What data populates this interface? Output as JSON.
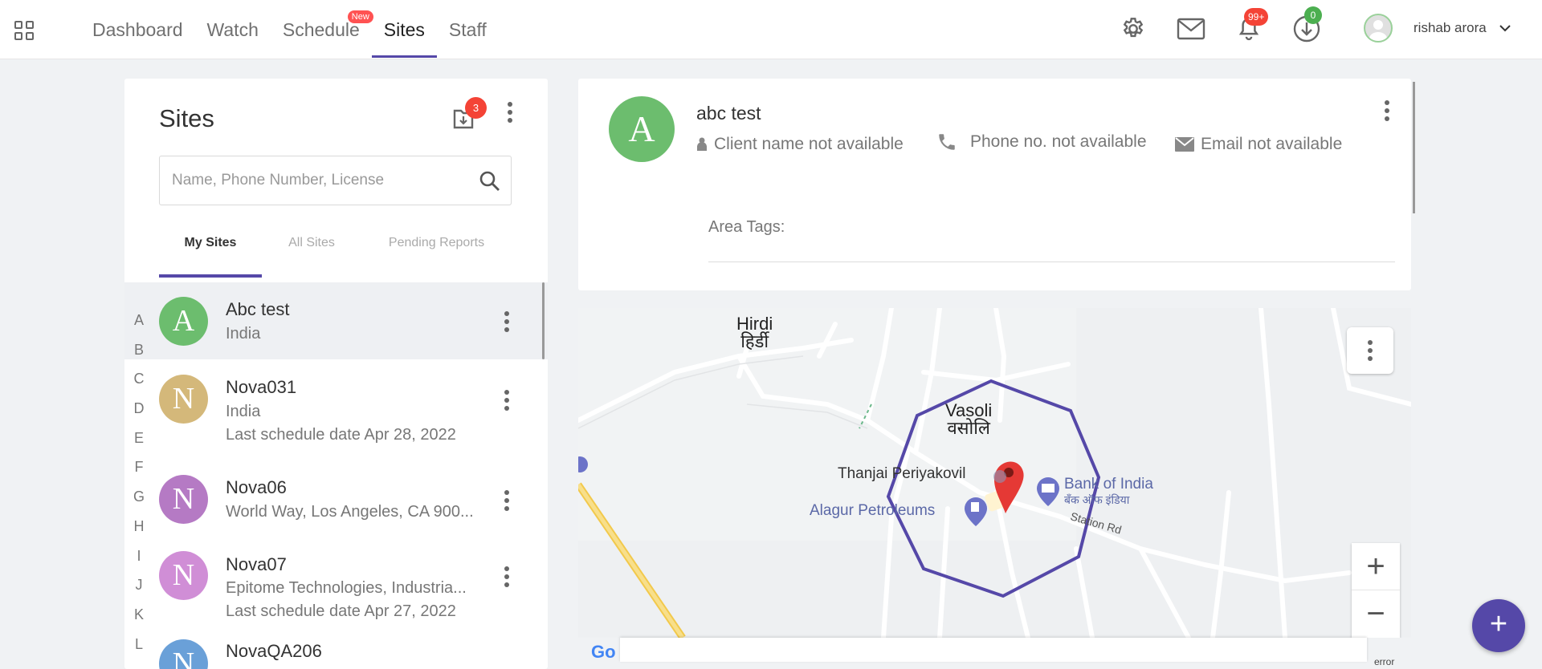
{
  "nav": {
    "tabs": [
      {
        "label": "Dashboard",
        "active": false
      },
      {
        "label": "Watch",
        "active": false
      },
      {
        "label": "Schedule",
        "active": false,
        "badge": "New"
      },
      {
        "label": "Sites",
        "active": true
      },
      {
        "label": "Staff",
        "active": false
      }
    ]
  },
  "header": {
    "notifications_badge": "99+",
    "downloads_badge": "0",
    "user_name": "rishab arora",
    "icons": [
      "settings-icon",
      "mail-icon",
      "bell-icon",
      "download-icon"
    ]
  },
  "sites_panel": {
    "title": "Sites",
    "download_badge": "3",
    "search_placeholder": "Name, Phone Number, License",
    "tabs": [
      "My Sites",
      "All Sites",
      "Pending Reports"
    ],
    "alphabet": [
      "A",
      "B",
      "C",
      "D",
      "E",
      "F",
      "G",
      "H",
      "I",
      "J",
      "K",
      "L"
    ],
    "items": [
      {
        "initial": "A",
        "name": "Abc test",
        "line1": "India",
        "line2": "",
        "color": "#6cbd6e"
      },
      {
        "initial": "N",
        "name": "Nova031",
        "line1": "India",
        "line2": "Last schedule date Apr 28, 2022",
        "color": "#d4b87a"
      },
      {
        "initial": "N",
        "name": "Nova06",
        "line1": "World Way, Los Angeles, CA 900...",
        "line2": "",
        "color": "#b57ac4"
      },
      {
        "initial": "N",
        "name": "Nova07",
        "line1": "Epitome Technologies, Industria...",
        "line2": "Last schedule date Apr 27, 2022",
        "color": "#d08ed6"
      },
      {
        "initial": "N",
        "name": "NovaQA206",
        "line1": "",
        "line2": "",
        "color": "#6aa0d8"
      }
    ]
  },
  "detail": {
    "initial": "A",
    "title": "abc test",
    "client": "Client name not available",
    "phone": "Phone no. not available",
    "email": "Email not available",
    "area_tags_label": "Area Tags:"
  },
  "map": {
    "labels": {
      "hirdi": "Hirdi",
      "hirdi_hi": "हिर्डी",
      "vasoli": "Vasoli",
      "vasoli_hi": "वसोलि",
      "temple": "Thanjai Periyakovil",
      "petrol": "Alagur Petroleums",
      "bank": "Bank of India",
      "bank_hi": "बँक ऑफ इंडिया",
      "road": "Station Rd",
      "google": "Go",
      "error": "error"
    },
    "geofence_color": "#5548a8",
    "zoom_in": "+",
    "zoom_out": "−"
  },
  "fab_label": "+",
  "colors": {
    "accent": "#5548a8",
    "badge_red": "#f44336",
    "badge_green": "#4caf50"
  }
}
